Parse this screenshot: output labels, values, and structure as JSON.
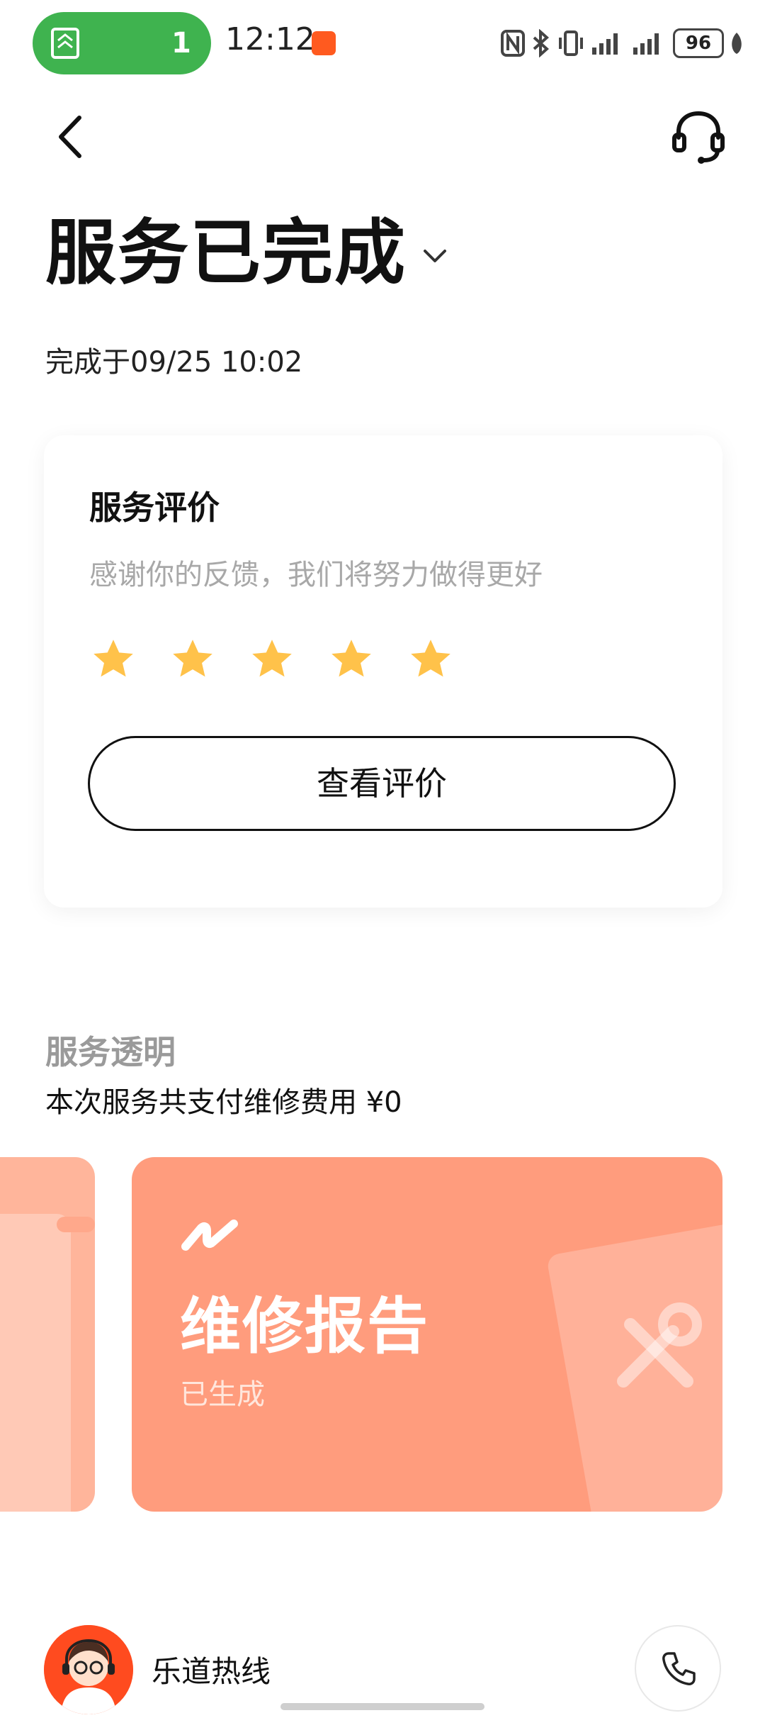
{
  "status_bar": {
    "call_count": "1",
    "time": "12:12",
    "battery": "96"
  },
  "header": {
    "title": "服务已完成",
    "completed_time": "完成于09/25 10:02"
  },
  "rating_card": {
    "title": "服务评价",
    "subtitle": "感谢你的反馈，我们将努力做得更好",
    "rating": 5,
    "max_rating": 5,
    "star_color": "#ffc24a",
    "button_label": "查看评价"
  },
  "transparency": {
    "title": "服务透明",
    "fee_line": "本次服务共支付维修费用 ¥0"
  },
  "report_card": {
    "title": "维修报告",
    "status": "已生成",
    "color": "#ff9c7d"
  },
  "hotline": {
    "label": "乐道热线"
  },
  "colors": {
    "accent_green": "#3fb34f",
    "text_primary": "#111111",
    "text_secondary": "#a8a8a8"
  },
  "icons": {
    "back": "back-arrow-icon",
    "support": "headset-icon",
    "expand": "chevron-down-icon",
    "star": "star-icon",
    "report_logo": "brand-wave-icon",
    "tools": "wrench-screwdriver-icon",
    "phone": "phone-icon"
  }
}
